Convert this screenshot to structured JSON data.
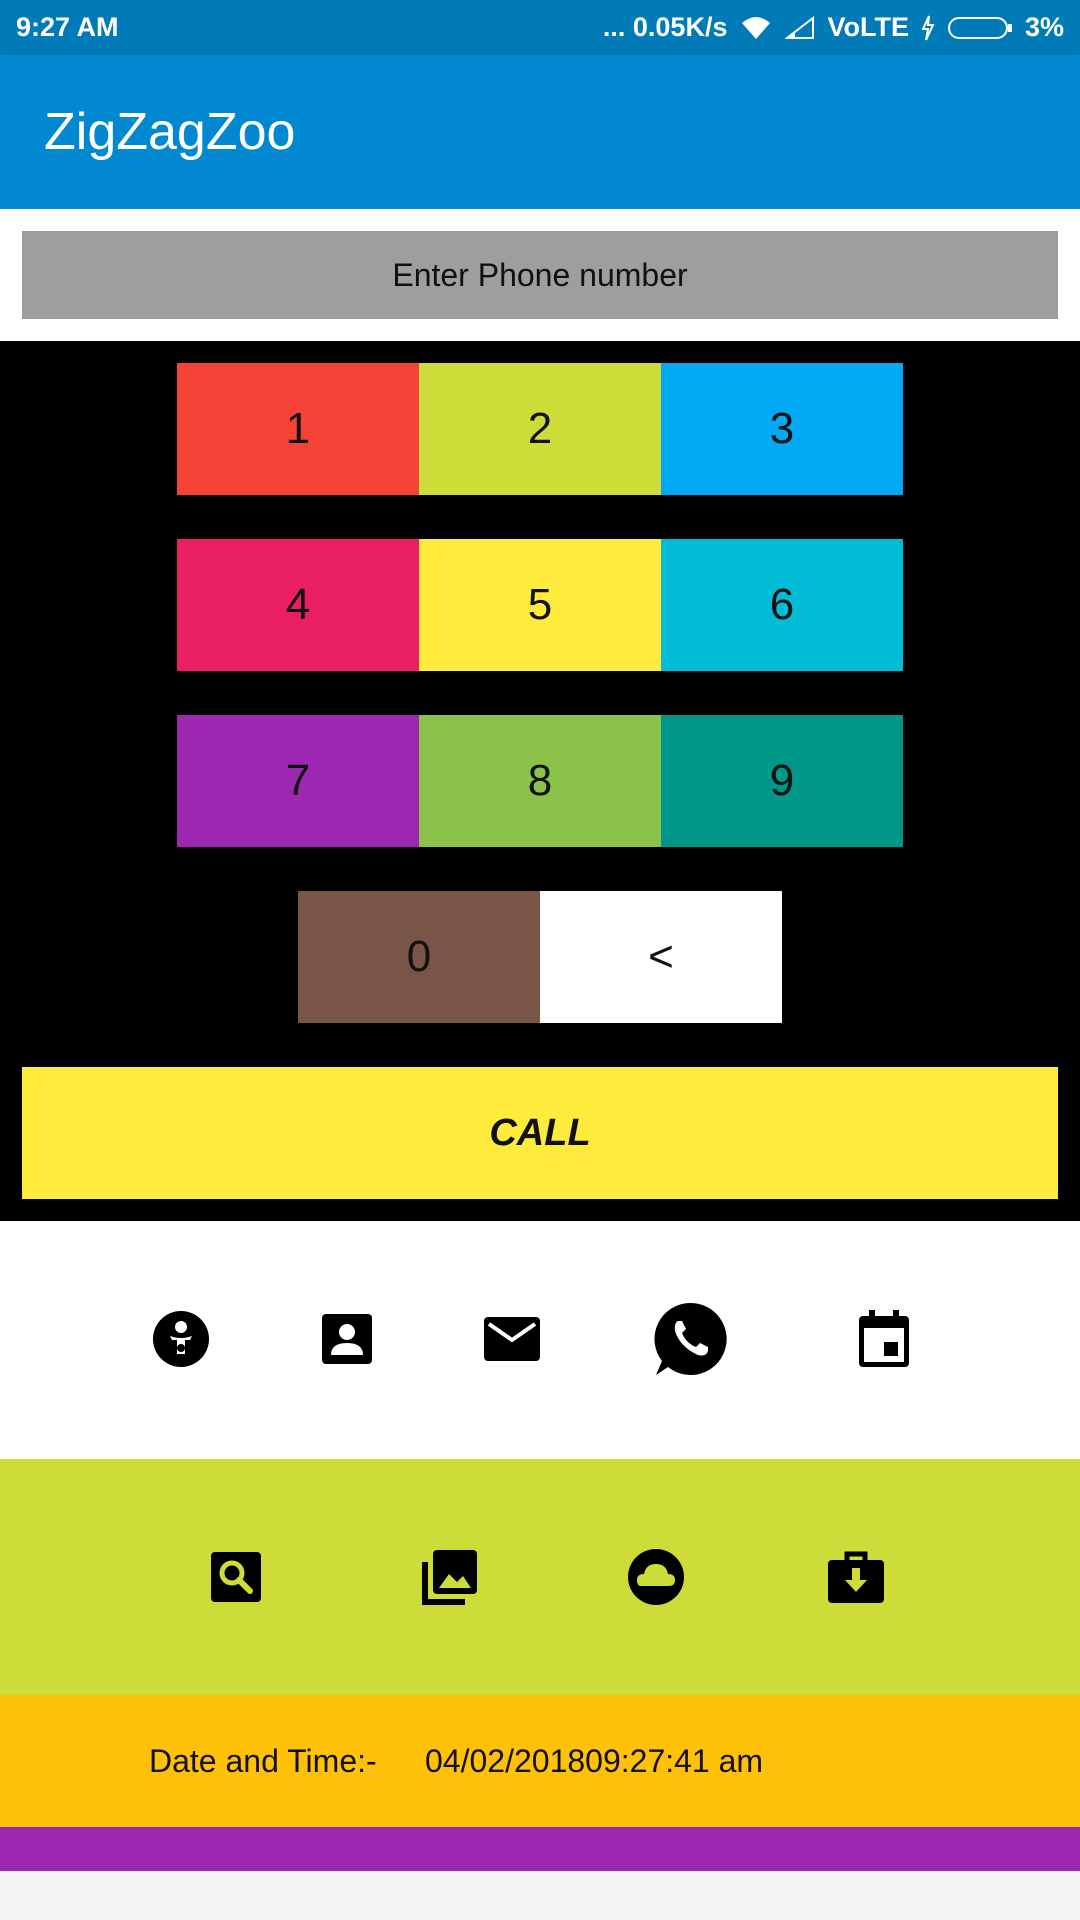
{
  "status_bar": {
    "time": "9:27 AM",
    "network_speed": "... 0.05K/s",
    "carrier": "VoLTE",
    "battery": "3%"
  },
  "app_bar": {
    "title": "ZigZagZoo"
  },
  "phone_input": {
    "placeholder": "Enter Phone number",
    "value": ""
  },
  "keypad": {
    "keys": [
      {
        "label": "1",
        "color": "#f44336"
      },
      {
        "label": "2",
        "color": "#cddc39"
      },
      {
        "label": "3",
        "color": "#03a9f4"
      },
      {
        "label": "4",
        "color": "#e91e63"
      },
      {
        "label": "5",
        "color": "#ffeb3b"
      },
      {
        "label": "6",
        "color": "#00bcd4"
      },
      {
        "label": "7",
        "color": "#9c27b0"
      },
      {
        "label": "8",
        "color": "#8bc34a"
      },
      {
        "label": "9",
        "color": "#009688"
      },
      {
        "label": "0",
        "color": "#795548"
      },
      {
        "label": "<",
        "color": "#ffffff"
      }
    ],
    "call_label": "CALL",
    "call_color": "#ffeb3b"
  },
  "icon_row_1": [
    "child-care-icon",
    "contact-icon",
    "mail-icon",
    "whatsapp-icon",
    "calendar-icon"
  ],
  "icon_row_2": [
    "image-search-icon",
    "photo-library-icon",
    "cloud-icon",
    "work-download-icon"
  ],
  "datetime": {
    "label": "Date and Time:-",
    "value": "04/02/201809:27:41 am"
  },
  "colors": {
    "status_bar": "#007bb8",
    "app_bar": "#0288d1",
    "row2_bg": "#cddc39",
    "datetime_bg": "#ffc107",
    "purple_bar": "#9c27b0"
  }
}
